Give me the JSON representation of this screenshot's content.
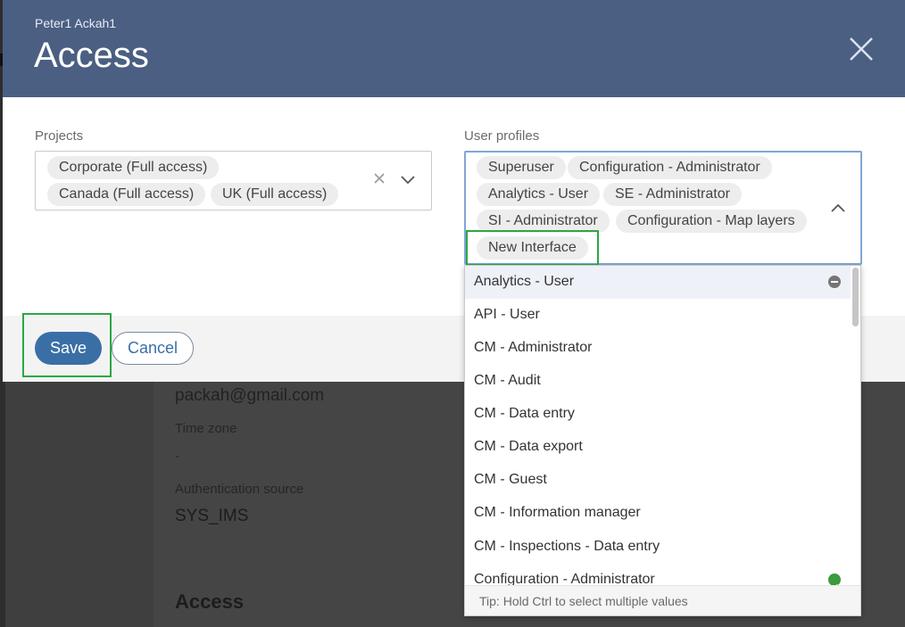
{
  "background": {
    "email": "packah@gmail.com",
    "time_zone_label": "Time zone",
    "time_zone_value": "-",
    "auth_source_label": "Authentication source",
    "auth_source_value": "SYS_IMS",
    "access_heading": "Access"
  },
  "modal": {
    "subtitle": "Peter1 Ackah1",
    "title": "Access",
    "close_icon": "close-icon",
    "projects": {
      "label": "Projects",
      "chips": [
        "Corporate (Full access)",
        "Canada (Full access)",
        "UK (Full access)"
      ]
    },
    "user_profiles": {
      "label": "User profiles",
      "chips": [
        "Superuser",
        "Configuration - Administrator",
        "Analytics - User",
        "SE - Administrator",
        "SI - Administrator",
        "Configuration - Map layers",
        "New Interface"
      ]
    },
    "footer": {
      "save_label": "Save",
      "cancel_label": "Cancel"
    }
  },
  "dropdown": {
    "options": [
      {
        "label": "Analytics - User",
        "status": "remove",
        "highlighted": true
      },
      {
        "label": "API - User",
        "status": "none"
      },
      {
        "label": "CM - Administrator",
        "status": "none"
      },
      {
        "label": "CM - Audit",
        "status": "none"
      },
      {
        "label": "CM - Data entry",
        "status": "none"
      },
      {
        "label": "CM - Data export",
        "status": "none"
      },
      {
        "label": "CM - Guest",
        "status": "none"
      },
      {
        "label": "CM - Information manager",
        "status": "none"
      },
      {
        "label": "CM - Inspections - Data entry",
        "status": "none"
      },
      {
        "label": "Configuration - Administrator",
        "status": "selected"
      }
    ],
    "tip": "Tip: Hold Ctrl to select multiple values"
  },
  "colors": {
    "header": "#4a5f82",
    "primary_button": "#3a6fa6",
    "annotation_box": "#2aa844",
    "selected_check": "#3d9a3f"
  }
}
